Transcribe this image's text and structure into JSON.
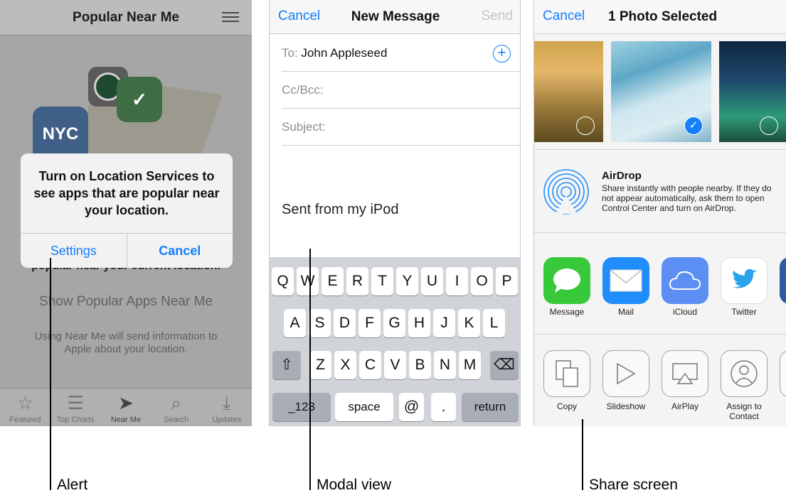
{
  "alert_panel": {
    "nav_title": "Popular Near Me",
    "partial_text": "popular near your current location.",
    "show_link": "Show Popular Apps Near Me",
    "note": "Using Near Me will send information to Apple about your location.",
    "app_badges": {
      "nyc": "NYC"
    },
    "tabs": [
      {
        "label": "Featured",
        "icon": "star-icon"
      },
      {
        "label": "Top Charts",
        "icon": "list-icon"
      },
      {
        "label": "Near Me",
        "icon": "location-arrow-icon",
        "active": true
      },
      {
        "label": "Search",
        "icon": "search-icon"
      },
      {
        "label": "Updates",
        "icon": "download-icon"
      }
    ],
    "alert": {
      "message": "Turn on Location Services to see apps that are popular near your location.",
      "buttons": [
        "Settings",
        "Cancel"
      ]
    }
  },
  "modal_panel": {
    "nav": {
      "left": "Cancel",
      "title": "New Message",
      "right": "Send"
    },
    "to_label": "To:",
    "to_value": "John Appleseed",
    "cc_label": "Cc/Bcc:",
    "subject_label": "Subject:",
    "body": "Sent from my iPod",
    "keyboard": {
      "row1": [
        "Q",
        "W",
        "E",
        "R",
        "T",
        "Y",
        "U",
        "I",
        "O",
        "P"
      ],
      "row2": [
        "A",
        "S",
        "D",
        "F",
        "G",
        "H",
        "J",
        "K",
        "L"
      ],
      "row3": [
        "Z",
        "X",
        "C",
        "V",
        "B",
        "N",
        "M"
      ],
      "row4": [
        "_123",
        "space",
        "@",
        ".",
        "return"
      ]
    }
  },
  "share_panel": {
    "nav": {
      "left": "Cancel",
      "title": "1 Photo Selected"
    },
    "airdrop": {
      "title": "AirDrop",
      "description": "Share instantly with people nearby. If they do not appear automatically, ask them to open Control Center and turn on AirDrop."
    },
    "share_targets": [
      "Message",
      "Mail",
      "iCloud",
      "Twitter"
    ],
    "actions": [
      "Copy",
      "Slideshow",
      "AirPlay",
      "Assign to Contact"
    ],
    "colors": {
      "message": "#38c93a",
      "mail": "#1f8dfb",
      "icloud": "#5c8ff3",
      "twitter": "#ffffff",
      "accent": "#147efb"
    }
  },
  "callouts": [
    "Alert",
    "Modal view",
    "Share screen"
  ]
}
